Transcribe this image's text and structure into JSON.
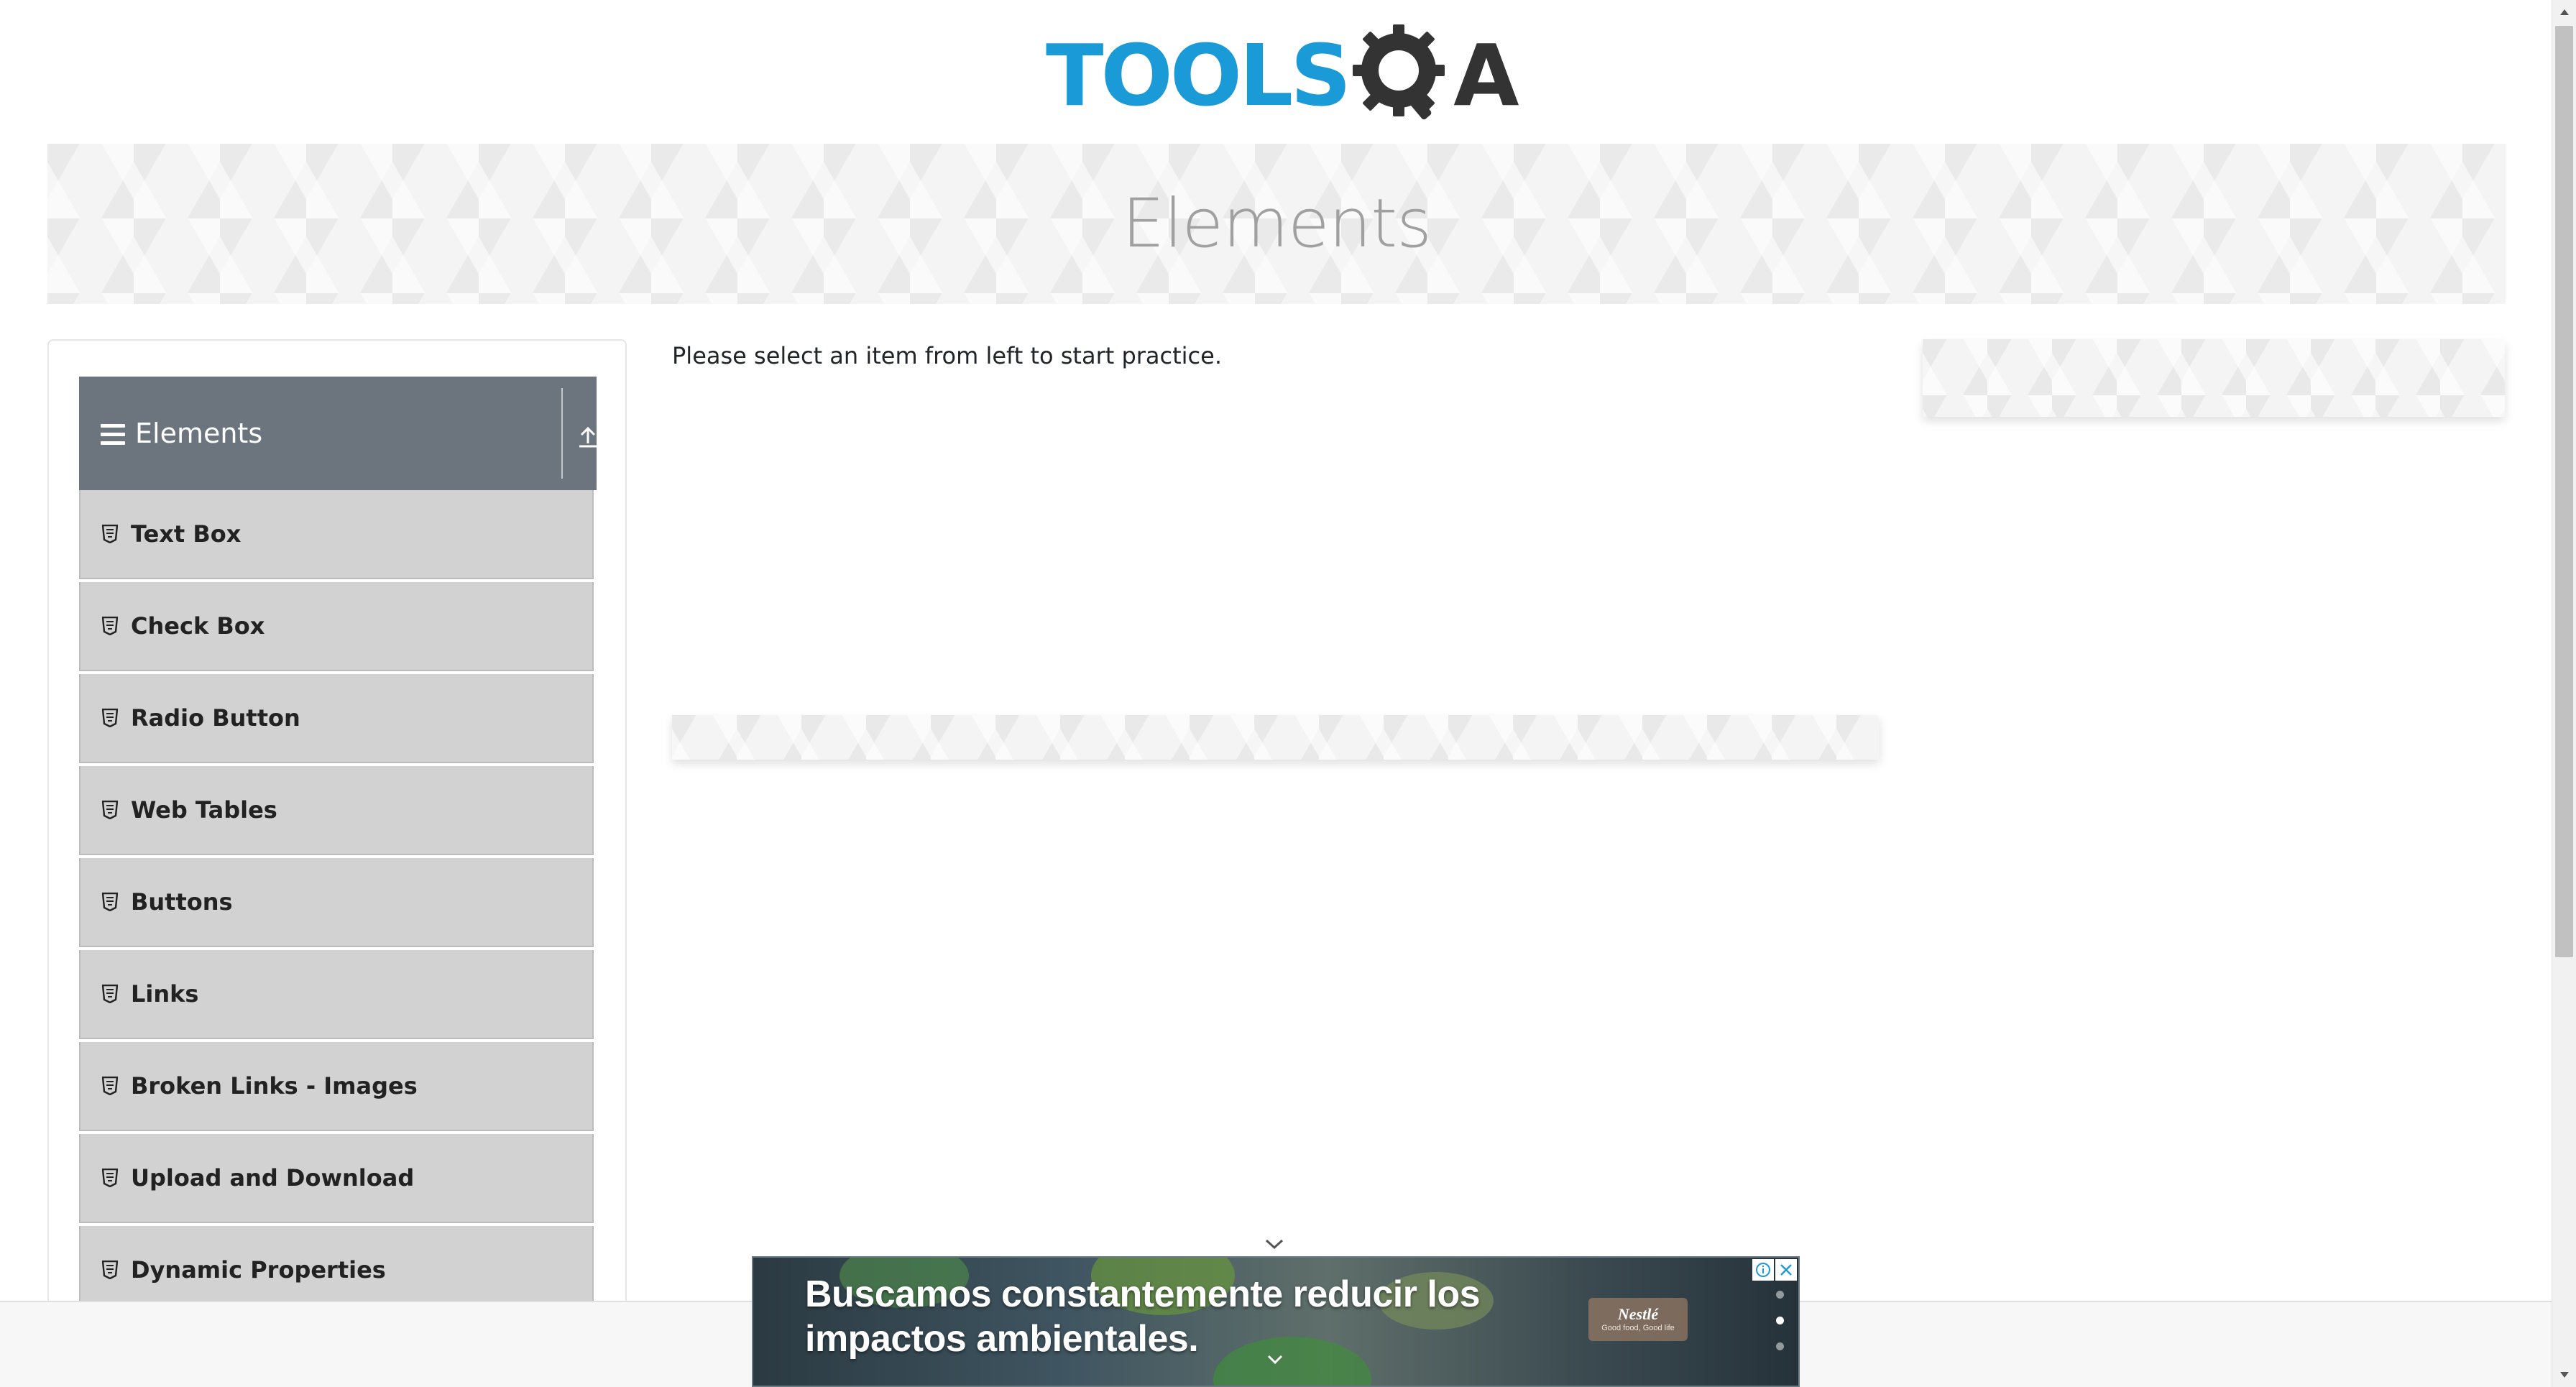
{
  "header": {
    "logo_text": "TOOLS",
    "logo_suffix": "A",
    "logo_icon": "gear-magnifier-icon",
    "brand_colors": {
      "primary": "#1a9bd7",
      "dark": "#333333"
    }
  },
  "banner": {
    "title": "Elements"
  },
  "sidebar": {
    "group": {
      "title": "Elements",
      "menu_icon": "hamburger-icon",
      "collapse_icon": "collapse-up-icon",
      "header_color": "#6c757d"
    },
    "items": [
      {
        "label": "Text Box",
        "icon": "shield-icon"
      },
      {
        "label": "Check Box",
        "icon": "shield-icon"
      },
      {
        "label": "Radio Button",
        "icon": "shield-icon"
      },
      {
        "label": "Web Tables",
        "icon": "shield-icon"
      },
      {
        "label": "Buttons",
        "icon": "shield-icon"
      },
      {
        "label": "Links",
        "icon": "shield-icon"
      },
      {
        "label": "Broken Links - Images",
        "icon": "shield-icon"
      },
      {
        "label": "Upload and Download",
        "icon": "shield-icon"
      },
      {
        "label": "Dynamic Properties",
        "icon": "shield-icon"
      }
    ]
  },
  "main": {
    "instruction": "Please select an item from left to start practice."
  },
  "bottom_ad": {
    "headline_line1": "Buscamos constantemente reducir los",
    "headline_line2": "impactos ambientales.",
    "brand_name": "Nestlé",
    "brand_tagline": "Good food, Good life",
    "info_icon": "ad-info-icon",
    "close_icon": "close-icon",
    "carousel_dot_count": 3,
    "carousel_active_index": 1
  }
}
